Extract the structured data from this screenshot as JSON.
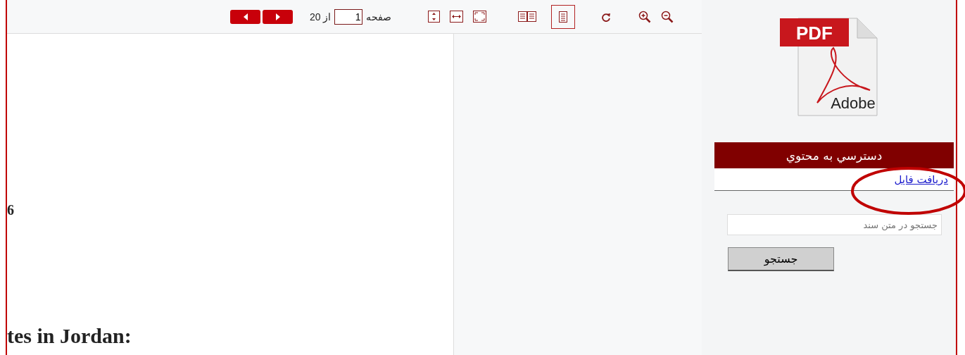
{
  "toolbar": {
    "page_label": "صفحه",
    "page_input": "1",
    "of_label": "از 20",
    "view_modes": [
      {
        "kind": "two-page",
        "selected": false
      },
      {
        "kind": "single-page",
        "selected": true
      }
    ]
  },
  "document": {
    "fragments": [
      "6",
      "tes in Jordan:"
    ]
  },
  "sidebar": {
    "logo_texts": [
      "PDF",
      "Adobe"
    ],
    "header": "دسترسي به محتوي",
    "download_link": "دریافت فایل",
    "search": {
      "placeholder": "جستجو در متن سند"
    },
    "search_button": "جستجو"
  }
}
